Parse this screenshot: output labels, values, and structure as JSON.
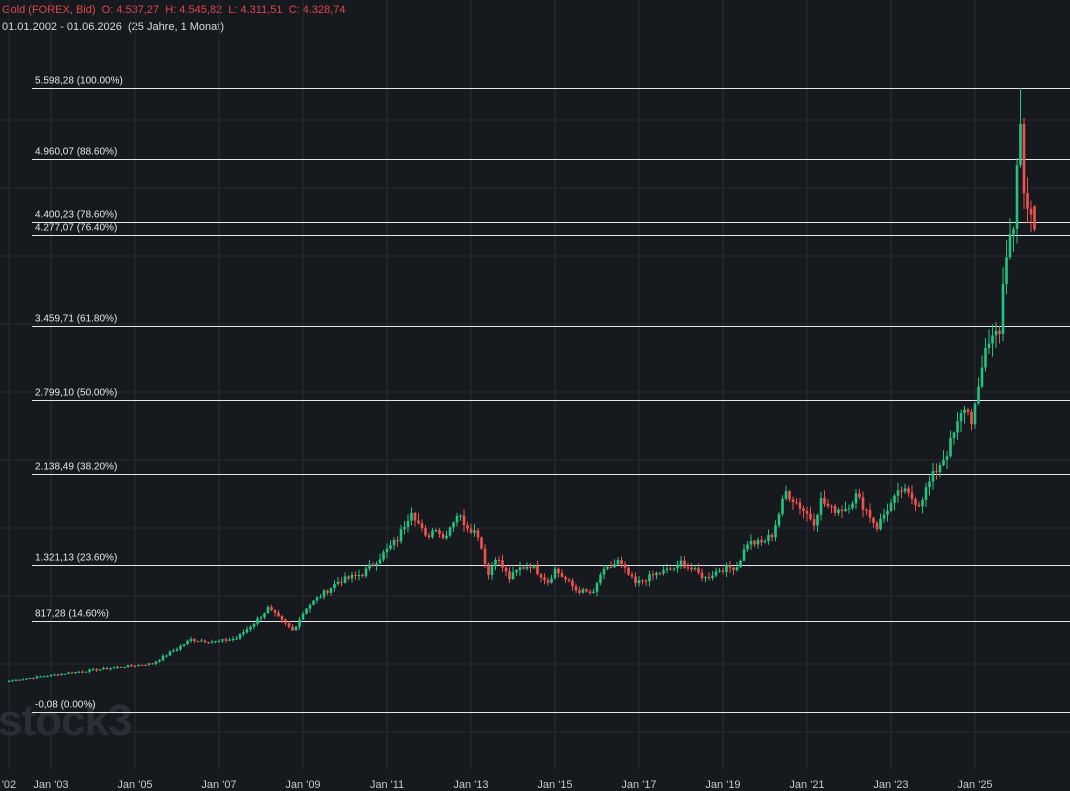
{
  "header": {
    "instrument": "Gold (FOREX, Bid)",
    "ohlc": "O: 4.537,27  H: 4.545,82  L: 4.311,51  C: 4.328,74",
    "range": "01.01.2002 - 01.06.2026  (25 Jahre, 1 Monat)"
  },
  "watermark": "stock3",
  "colors": {
    "background": "#161a1f",
    "up": "#26c281",
    "down": "#ef5350",
    "level_line": "#e6e6e6",
    "grid": "#262b31"
  },
  "chart_data": {
    "type": "candlestick",
    "interval": "monthly",
    "xlabels": [
      "'02",
      "Jan '03",
      "Jan '05",
      "Jan '07",
      "Jan '09",
      "Jan '11",
      "Jan '13",
      "Jan '15",
      "Jan '17",
      "Jan '19",
      "Jan '21",
      "Jan '23",
      "Jan '25"
    ],
    "xlabel_years": [
      2002,
      2003,
      2005,
      2007,
      2009,
      2011,
      2013,
      2015,
      2017,
      2019,
      2021,
      2023,
      2025
    ],
    "x_range": [
      "2002-01",
      "2026-06"
    ],
    "ylim": [
      -0.08,
      5598.28
    ],
    "fib_levels": [
      {
        "label": "5.598,28 (100.00%)",
        "value": 5598.28
      },
      {
        "label": "4.960,07 (88.60%)",
        "value": 4960.07
      },
      {
        "label": "4.400,23 (78.60%)",
        "value": 4400.23
      },
      {
        "label": "4.277,07 (76.40%)",
        "value": 4277.07
      },
      {
        "label": "3.459,71 (61.80%)",
        "value": 3459.71
      },
      {
        "label": "2.799,10 (50.00%)",
        "value": 2799.1
      },
      {
        "label": "2.138,49 (38.20%)",
        "value": 2138.49
      },
      {
        "label": "1.321,13 (23.60%)",
        "value": 1321.13
      },
      {
        "label": "817,28 (14.60%)",
        "value": 817.28
      },
      {
        "label": "-0,08 (0.00%)",
        "value": -0.08
      }
    ],
    "anchors": [
      {
        "date": "2002-01",
        "close": 280
      },
      {
        "date": "2003-06",
        "close": 350
      },
      {
        "date": "2004-06",
        "close": 395
      },
      {
        "date": "2005-06",
        "close": 435
      },
      {
        "date": "2006-05",
        "close": 650
      },
      {
        "date": "2006-12",
        "close": 630
      },
      {
        "date": "2007-06",
        "close": 660
      },
      {
        "date": "2007-12",
        "close": 830
      },
      {
        "date": "2008-03",
        "close": 930
      },
      {
        "date": "2008-10",
        "close": 730
      },
      {
        "date": "2009-02",
        "close": 940
      },
      {
        "date": "2009-11",
        "close": 1170
      },
      {
        "date": "2010-06",
        "close": 1240
      },
      {
        "date": "2010-12",
        "close": 1420
      },
      {
        "date": "2011-04",
        "close": 1550
      },
      {
        "date": "2011-08",
        "close": 1820
      },
      {
        "date": "2011-12",
        "close": 1560
      },
      {
        "date": "2012-03",
        "close": 1665
      },
      {
        "date": "2012-05",
        "close": 1560
      },
      {
        "date": "2012-09",
        "close": 1775
      },
      {
        "date": "2012-12",
        "close": 1670
      },
      {
        "date": "2013-03",
        "close": 1595
      },
      {
        "date": "2013-06",
        "close": 1230
      },
      {
        "date": "2013-08",
        "close": 1395
      },
      {
        "date": "2013-12",
        "close": 1200
      },
      {
        "date": "2014-03",
        "close": 1290
      },
      {
        "date": "2014-06",
        "close": 1320
      },
      {
        "date": "2014-11",
        "close": 1170
      },
      {
        "date": "2015-01",
        "close": 1280
      },
      {
        "date": "2015-07",
        "close": 1095
      },
      {
        "date": "2015-12",
        "close": 1060
      },
      {
        "date": "2016-02",
        "close": 1235
      },
      {
        "date": "2016-07",
        "close": 1350
      },
      {
        "date": "2016-12",
        "close": 1150
      },
      {
        "date": "2017-06",
        "close": 1240
      },
      {
        "date": "2017-12",
        "close": 1300
      },
      {
        "date": "2018-01",
        "close": 1345
      },
      {
        "date": "2018-08",
        "close": 1200
      },
      {
        "date": "2018-12",
        "close": 1280
      },
      {
        "date": "2019-05",
        "close": 1305
      },
      {
        "date": "2019-08",
        "close": 1520
      },
      {
        "date": "2019-12",
        "close": 1515
      },
      {
        "date": "2020-03",
        "close": 1590
      },
      {
        "date": "2020-07",
        "close": 1975
      },
      {
        "date": "2020-10",
        "close": 1880
      },
      {
        "date": "2021-03",
        "close": 1710
      },
      {
        "date": "2021-05",
        "close": 1900
      },
      {
        "date": "2021-08",
        "close": 1815
      },
      {
        "date": "2021-12",
        "close": 1830
      },
      {
        "date": "2022-03",
        "close": 1940
      },
      {
        "date": "2022-06",
        "close": 1810
      },
      {
        "date": "2022-09",
        "close": 1660
      },
      {
        "date": "2022-12",
        "close": 1825
      },
      {
        "date": "2023-04",
        "close": 1990
      },
      {
        "date": "2023-09",
        "close": 1870
      },
      {
        "date": "2023-12",
        "close": 2060
      },
      {
        "date": "2024-03",
        "close": 2230
      },
      {
        "date": "2024-05",
        "close": 2330
      },
      {
        "date": "2024-10",
        "close": 2740
      },
      {
        "date": "2024-12",
        "close": 2625
      },
      {
        "date": "2025-02",
        "close": 2860
      },
      {
        "date": "2025-04",
        "close": 3290
      },
      {
        "date": "2025-08",
        "close": 3450
      },
      {
        "date": "2025-09",
        "close": 3860
      },
      {
        "date": "2025-10",
        "close": 4020
      },
      {
        "date": "2025-11",
        "close": 4240
      },
      {
        "date": "2025-12",
        "close": 4330
      },
      {
        "date": "2026-01",
        "close": 4900
      },
      {
        "date": "2026-02",
        "close": 5250
      },
      {
        "date": "2026-03",
        "close": 4680
      },
      {
        "date": "2026-04",
        "close": 4600
      },
      {
        "date": "2026-05",
        "close": 4537.27
      },
      {
        "date": "2026-06",
        "open": 4537.27,
        "high": 4545.82,
        "low": 4311.51,
        "close": 4328.74
      }
    ],
    "all_time_high": 5598.28
  }
}
